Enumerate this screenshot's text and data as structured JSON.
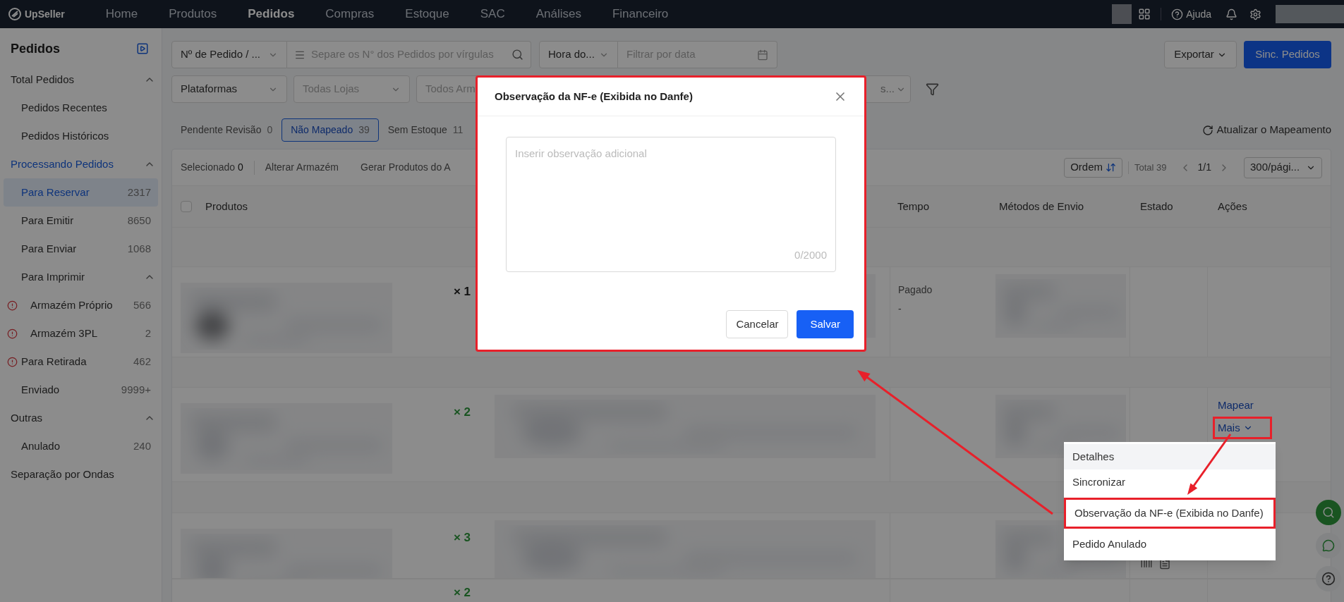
{
  "nav": {
    "brand": "UpSeller",
    "items": [
      {
        "label": "Home",
        "selected": false
      },
      {
        "label": "Produtos",
        "selected": false
      },
      {
        "label": "Pedidos",
        "selected": true
      },
      {
        "label": "Compras",
        "selected": false
      },
      {
        "label": "Estoque",
        "selected": false
      },
      {
        "label": "SAC",
        "selected": false
      },
      {
        "label": "Análises",
        "selected": false
      },
      {
        "label": "Financeiro",
        "selected": false
      }
    ],
    "help": "Ajuda"
  },
  "sidebar": {
    "title": "Pedidos",
    "groups": [
      {
        "label": "Total Pedidos",
        "expanded": true,
        "items": [
          {
            "label": "Pedidos Recentes",
            "selected": false
          },
          {
            "label": "Pedidos Históricos",
            "selected": false
          }
        ]
      },
      {
        "label": "Processando Pedidos",
        "expanded": true,
        "items": [
          {
            "label": "Para Reservar",
            "count": "2317",
            "selected": true,
            "warning": false
          },
          {
            "label": "Para Emitir",
            "count": "8650",
            "selected": false,
            "warning": false
          },
          {
            "label": "Para Enviar",
            "count": "1068",
            "selected": false,
            "warning": false
          },
          {
            "label": "Para Imprimir",
            "selected": false,
            "warning": false,
            "expanded": true,
            "children": [
              {
                "label": "Armazém Próprio",
                "count": "566",
                "selected": false,
                "warning": true
              },
              {
                "label": "Armazém 3PL",
                "count": "2",
                "selected": false,
                "warning": true
              }
            ]
          },
          {
            "label": "Para Retirada",
            "count": "462",
            "selected": false,
            "warning": true
          },
          {
            "label": "Enviado",
            "count": "9999+",
            "selected": false,
            "warning": false
          }
        ]
      },
      {
        "label": "Outras",
        "expanded": true,
        "items": [
          {
            "label": "Anulado",
            "count": "240",
            "selected": false,
            "warning": false
          }
        ]
      },
      {
        "label": "Separação por Ondas"
      }
    ]
  },
  "filters": {
    "order_type": "Nº de Pedido / ...",
    "search_placeholder": "Separe os N° dos Pedidos por vírgulas",
    "time_type": "Hora do...",
    "date_placeholder": "Filtrar por data",
    "platform": "Plataformas",
    "stores": "Todas Lojas",
    "warehouses": "Todos Arm",
    "other": "s...",
    "export": "Exportar",
    "sync": "Sinc. Pedidos"
  },
  "status_tabs": [
    {
      "label": "Pendente Revisão",
      "count": "0",
      "selected": false
    },
    {
      "label": "Não Mapeado",
      "count": "39",
      "selected": true
    },
    {
      "label": "Sem Estoque",
      "count": "11",
      "selected": false
    }
  ],
  "refresh": "Atualizar o Mapeamento",
  "toolbar": {
    "selected_label": "Selecionado",
    "selected_count": "0",
    "actions": [
      "Alterar Armazém",
      "Gerar Produtos do A"
    ],
    "sort": "Ordem",
    "total": "Total 39",
    "page": "1/1",
    "page_size": "300/pági..."
  },
  "table": {
    "select_all": {
      "checked": false
    },
    "columns": [
      "Produtos",
      "Tempo",
      "Métodos de Envio",
      "Estado",
      "Ações"
    ],
    "rows": [
      {
        "quantity": "× 1",
        "emphasized": false,
        "time": [
          "Pagado",
          "-"
        ]
      },
      {
        "quantity": "× 2",
        "emphasized": true,
        "actions": [
          {
            "label": "Mapear",
            "highlighted": false
          },
          {
            "label": "Mais",
            "highlighted": true
          }
        ]
      },
      {
        "quantity": "× 3",
        "emphasized": true
      },
      {
        "quantity": "× 2",
        "emphasized": true
      }
    ]
  },
  "modal": {
    "title": "Observação da NF-e (Exibida no Danfe)",
    "placeholder": "Inserir observação adicional",
    "counter": "0/2000",
    "cancel": "Cancelar",
    "save": "Salvar",
    "highlighted": true
  },
  "menu": [
    {
      "label": "Detalhes",
      "hovered": true,
      "highlighted": false
    },
    {
      "label": "Sincronizar",
      "hovered": false,
      "highlighted": false
    },
    {
      "label": "Observação da NF-e (Exibida no Danfe)",
      "hovered": false,
      "highlighted": true
    },
    {
      "label": "Pedido Anulado",
      "hovered": false,
      "highlighted": false
    }
  ]
}
